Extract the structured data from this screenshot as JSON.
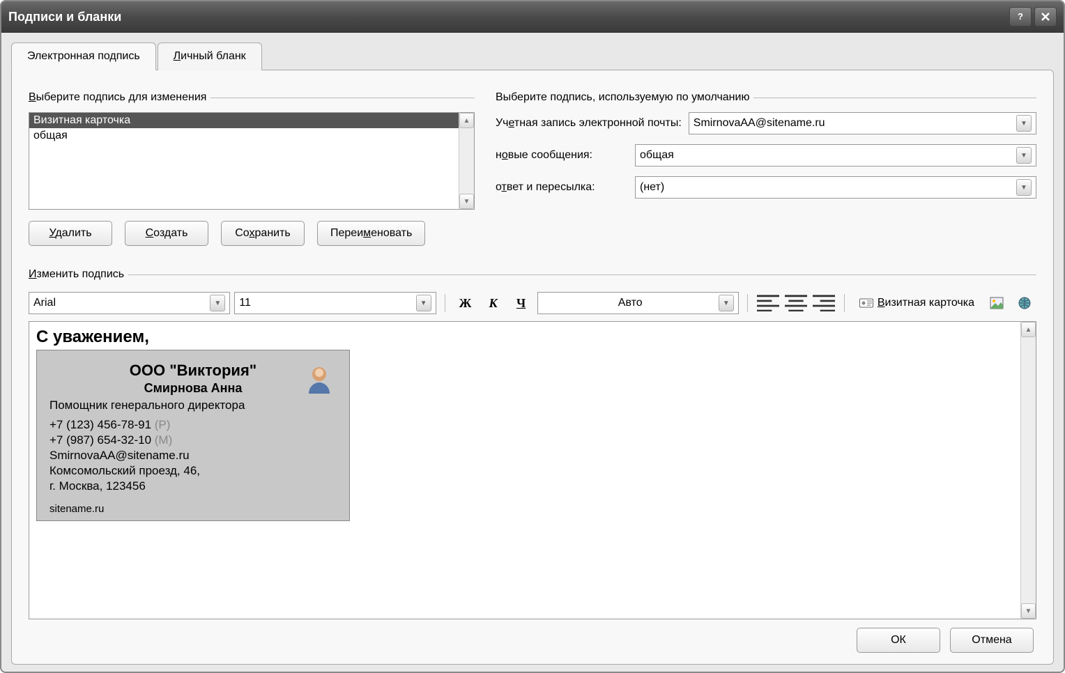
{
  "window": {
    "title": "Подписи и бланки"
  },
  "tabs": {
    "t1": "Электронная подпись",
    "t2": "Личный бланк"
  },
  "left": {
    "legend": "Выберите подпись для изменения",
    "items": [
      "Визитная карточка",
      "общая"
    ],
    "buttons": {
      "delete": "Удалить",
      "create": "Создать",
      "save": "Сохранить",
      "rename": "Переименовать"
    }
  },
  "right": {
    "legend": "Выберите подпись, используемую по умолчанию",
    "account_label": "Учетная запись электронной почты:",
    "account_value": "SmirnovaAA@sitename.ru",
    "new_label": "новые сообщения:",
    "new_value": "общая",
    "reply_label": "ответ и пересылка:",
    "reply_value": "(нет)"
  },
  "edit": {
    "legend": "Изменить подпись",
    "font": "Arial",
    "size": "11",
    "bold": "Ж",
    "italic": "К",
    "underline": "Ч",
    "color": "Авто",
    "bizcard_btn": "Визитная карточка"
  },
  "signature": {
    "greeting": "С уважением,",
    "card": {
      "company": "ООО \"Виктория\"",
      "person": "Смирнова Анна",
      "jobtitle": "Помощник генерального директора",
      "phone1": "+7 (123) 456-78-91",
      "phone1_tag": "(Р)",
      "phone2": "+7 (987) 654-32-10",
      "phone2_tag": "(М)",
      "email": "SmirnovaAA@sitename.ru",
      "addr1": "Комсомольский проезд, 46,",
      "addr2": "г. Москва, 123456",
      "site": "sitename.ru"
    }
  },
  "footer": {
    "ok": "ОК",
    "cancel": "Отмена"
  }
}
